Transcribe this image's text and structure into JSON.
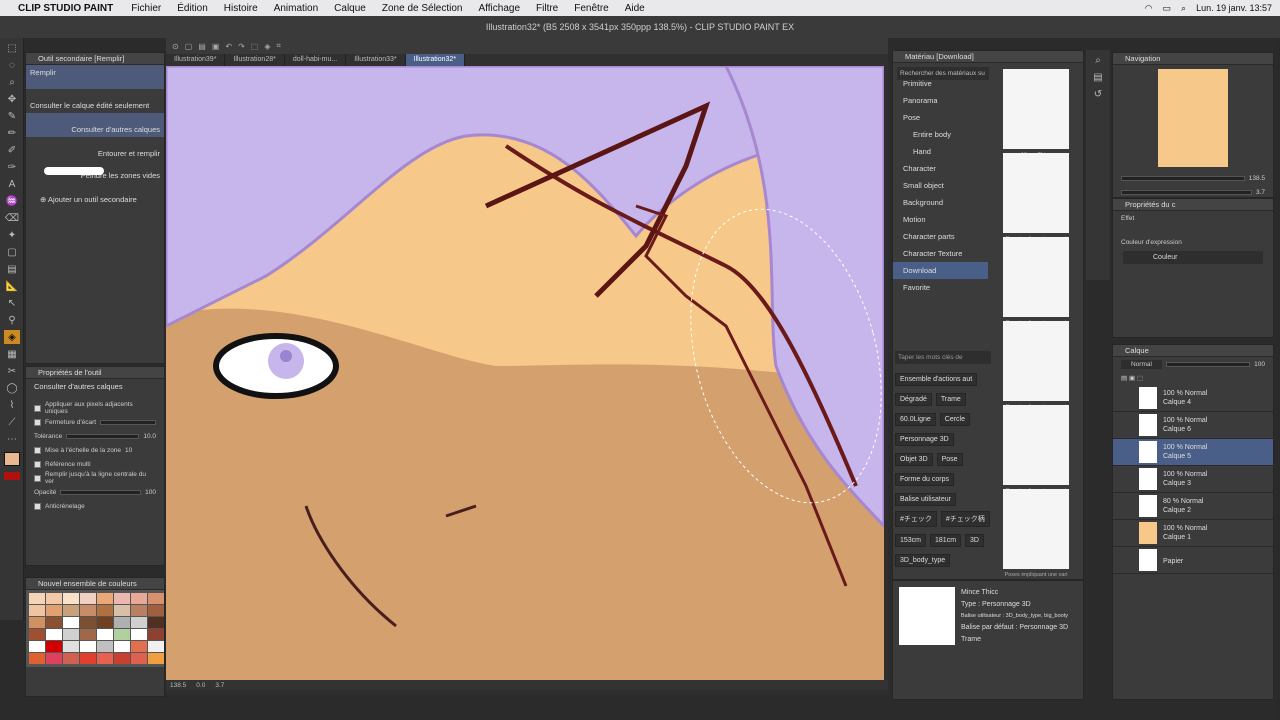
{
  "menubar": {
    "app": "CLIP STUDIO PAINT",
    "items": [
      "Fichier",
      "Édition",
      "Histoire",
      "Animation",
      "Calque",
      "Zone de Sélection",
      "Affichage",
      "Filtre",
      "Fenêtre",
      "Aide"
    ],
    "clock": "Lun. 19 janv.  13:57"
  },
  "title": "Illustration32* (B5 2508 x 3541px 350ppp 138.5%) - CLIP STUDIO PAINT EX",
  "subtool": {
    "header": "Outil secondaire [Remplir]",
    "active": "Remplir",
    "items": [
      "Consulter le calque édité seulement",
      "Consulter d'autres calques",
      "Entourer et remplir",
      "Peindre les zones vides"
    ],
    "add": "Ajouter un outil secondaire"
  },
  "toolprops": {
    "header": "Propriétés de l'outil",
    "tool": "Consulter d'autres calques",
    "rows": {
      "adjacent": "Appliquer aux pixels adjacents uniques",
      "gap": "Fermeture d'écart",
      "tolerance": "Tolérance",
      "tolerance_val": "10.0",
      "scale": "Mise à l'échelle de la zone",
      "scale_val": "10",
      "reference": "Référence multi",
      "centerline": "Remplir jusqu'à la ligne centrale du ver",
      "opacity": "Opacité",
      "opacity_val": "100",
      "antialias": "Anticrénelage"
    }
  },
  "colorset": {
    "name": "Nouvel ensemble de couleurs",
    "colors": [
      "#f5d4b8",
      "#f2c8a8",
      "#f7e1c9",
      "#f0d0c0",
      "#e8a878",
      "#eab8b0",
      "#e8a898",
      "#d8906e",
      "#f0c4a0",
      "#e0a070",
      "#caa07a",
      "#c88c68",
      "#b07040",
      "#d8c0a8",
      "#b88060",
      "#a06040",
      "#d09060",
      "#8a5030",
      "#ffffff",
      "#7a5030",
      "#704020",
      "#b0b0b0",
      "#d0d0d0",
      "#503020",
      "#a05030",
      "#ffffff",
      "#d0d0d0",
      "#a06848",
      "#ffffff",
      "#b0d0a0",
      "#ffffff",
      "#904030",
      "#ffffff",
      "#d00000",
      "#e0e0e0",
      "#ffffff",
      "#c0c0c0",
      "#ffffff",
      "#e07050",
      "#f0f0f0",
      "#e06030",
      "#e04060",
      "#d06050",
      "#e04030",
      "#e86050",
      "#c84030",
      "#e06050",
      "#f0a040"
    ]
  },
  "tabs": [
    "Illustration39*",
    "Illustration28*",
    "doll-habi-mu...",
    "Illustration33*",
    "Illustration32*"
  ],
  "canvas": {
    "zoom": "138.5",
    "angle": "0.0",
    "size": "3.7"
  },
  "material": {
    "header": "Matériau [Download]",
    "search": "Rechercher des matériaux su",
    "categories": [
      "Primitive",
      "Panorama",
      "Pose",
      "Entire body",
      "Hand",
      "Character",
      "Small object",
      "Background",
      "Motion",
      "Character parts",
      "Character Texture",
      "Download",
      "Favorite"
    ],
    "selected": "Download",
    "keyword": "Taper les mots clés de",
    "tags": [
      "Ensemble d'actions aut",
      "Dégradé",
      "Trame",
      "60.0Ligne",
      "Cercle",
      "Personnage 3D",
      "Objet 3D",
      "Pose",
      "Forme du corps",
      "Balise utilisateur",
      "#チェック",
      "#チェック柄",
      "153cm",
      "181cm",
      "3D",
      "3D_body_type"
    ],
    "thumbs": [
      "Mince Thicc",
      "Pose impliquant une vari",
      "Pose impliquant une vari",
      "Pose impliquant une vari",
      "Pose impliquant une vari",
      "Poses impliquant une vari"
    ]
  },
  "matinfo": {
    "name": "Mince Thicc",
    "type": "Type : Personnage 3D",
    "tag": "Balise utilisateur : 3D_body_type, big_booty",
    "default": "Balise par défaut : Personnage 3D",
    "trame": "Trame"
  },
  "navigation": {
    "header": "Navigation",
    "zoom": "138.5",
    "angle": "3.7"
  },
  "props": {
    "header": "Propriétés du c",
    "effect": "Effet",
    "expr_label": "Couleur d'expression",
    "expr": "Couleur"
  },
  "layers": {
    "header": "Calque",
    "blend": "Normal",
    "opacity": "100",
    "list": [
      {
        "mode": "100 % Normal",
        "name": "Calque 4"
      },
      {
        "mode": "100 % Normal",
        "name": "Calque 6"
      },
      {
        "mode": "100 % Normal",
        "name": "Calque 5"
      },
      {
        "mode": "100 % Normal",
        "name": "Calque 3"
      },
      {
        "mode": "80 % Normal",
        "name": "Calque 2"
      },
      {
        "mode": "100 % Normal",
        "name": "Calque 1"
      },
      {
        "mode": "",
        "name": "Papier"
      }
    ]
  }
}
